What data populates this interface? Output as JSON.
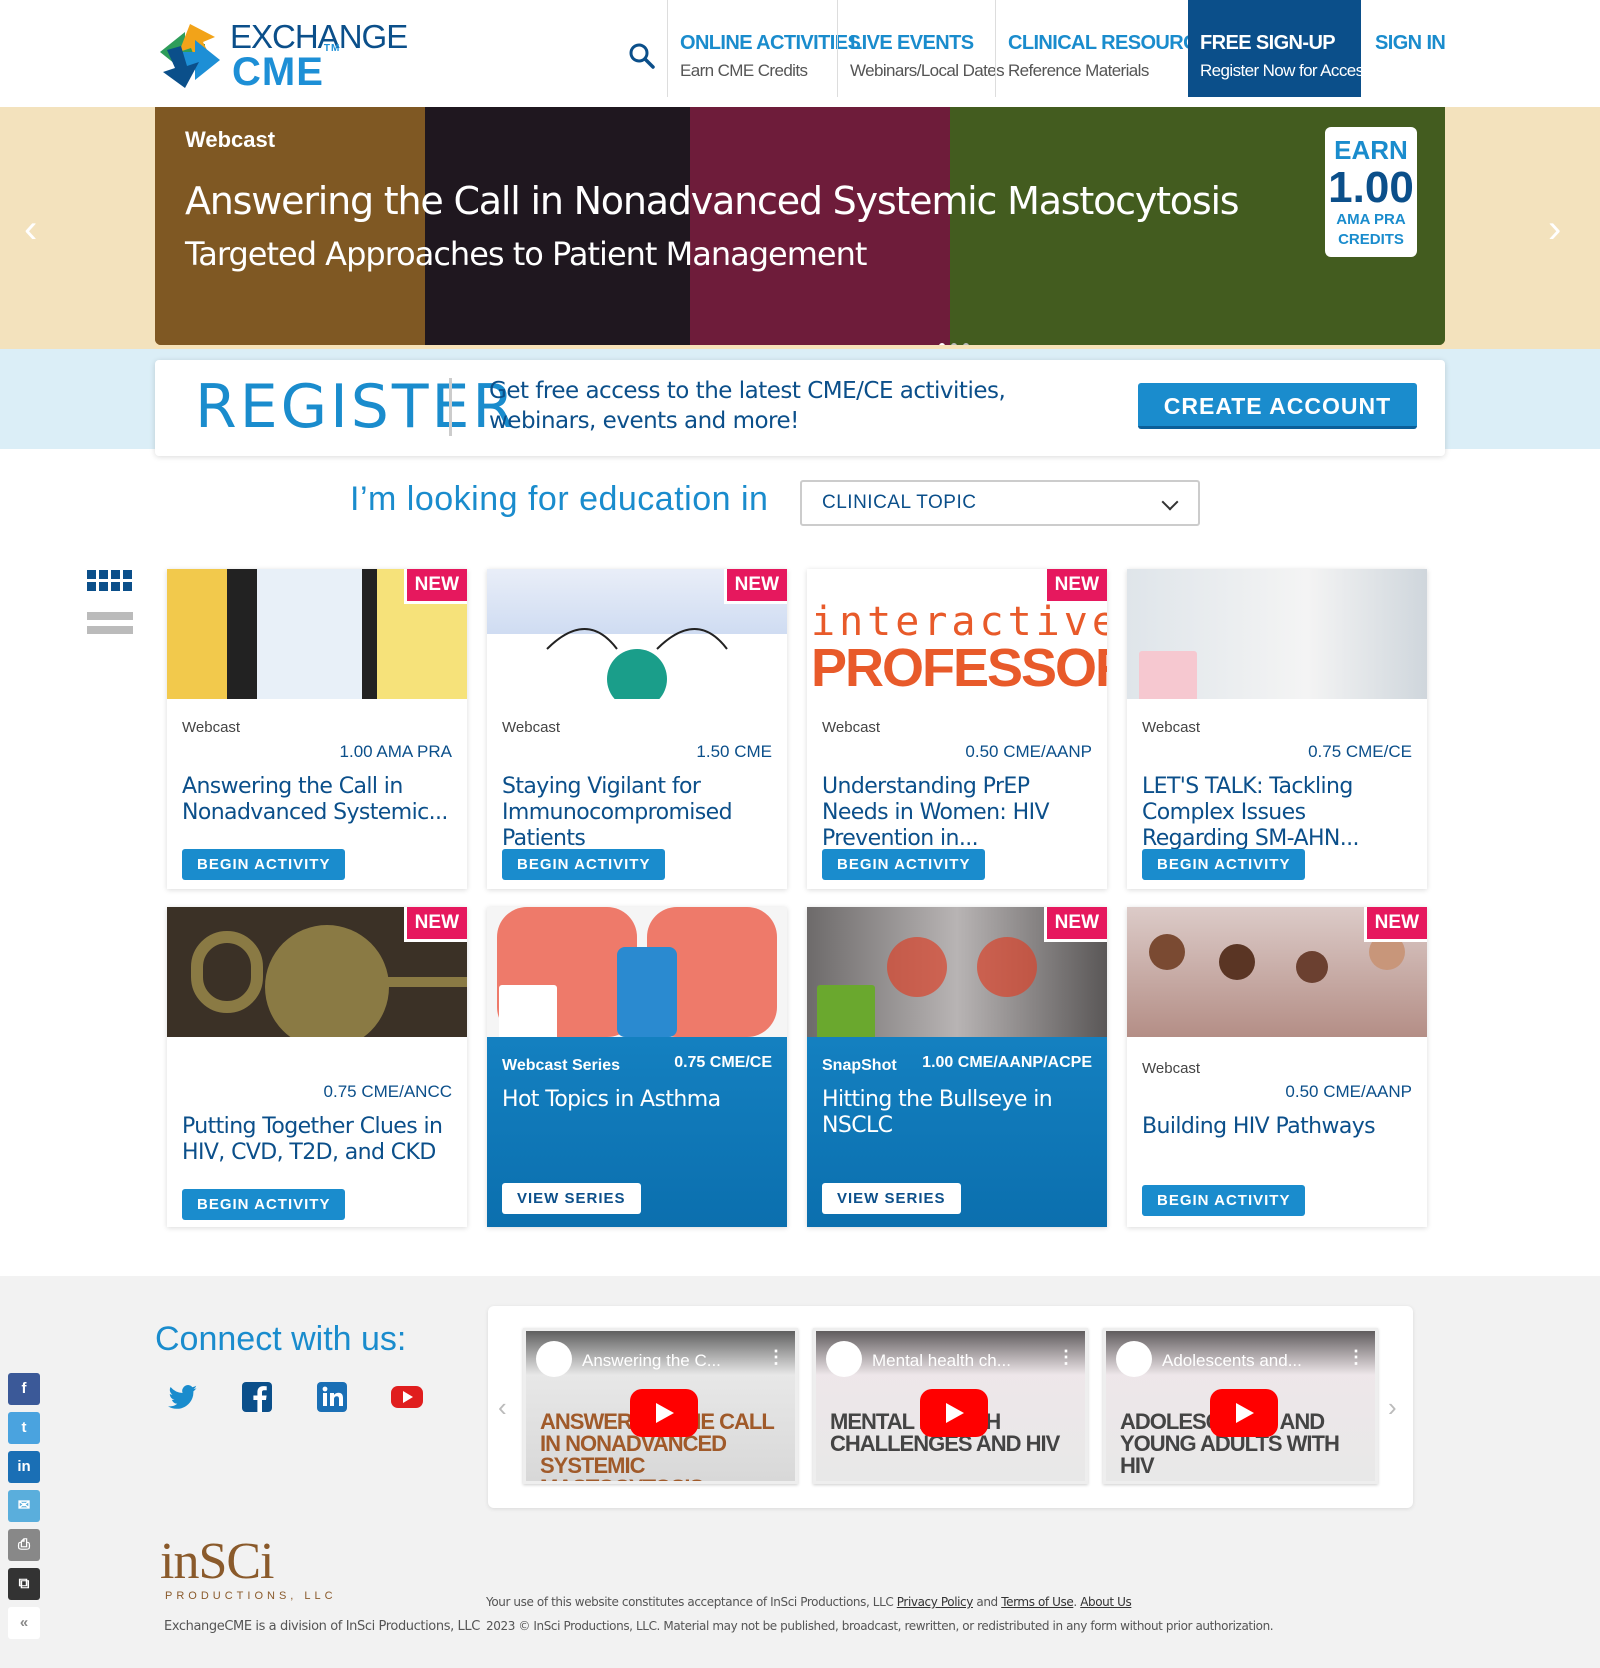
{
  "header": {
    "logo_line1": "EXCHANGE",
    "logo_line2": "CME",
    "logo_tm": "TM",
    "nav": [
      {
        "title": "ONLINE ACTIVITIES",
        "sub": "Earn CME Credits"
      },
      {
        "title": "LIVE EVENTS",
        "sub": "Webinars/Local Dates"
      },
      {
        "title": "CLINICAL RESOURCES",
        "sub": "Reference Materials"
      },
      {
        "title": "FREE SIGN-UP",
        "sub": "Register Now for Access"
      }
    ],
    "sign_in": "SIGN IN"
  },
  "hero": {
    "tag": "Webcast",
    "title": "Answering the Call in Nonadvanced Systemic Mastocytosis",
    "subtitle": "Targeted Approaches to Patient Management",
    "earn_label": "EARN",
    "earn_value": "1.00",
    "earn_unit": "AMA PRA CREDITS",
    "prev": "‹",
    "next": "›"
  },
  "register": {
    "title": "REGISTER",
    "text": "Get free access to the latest CME/CE activities, webinars, events and more!",
    "button": "CREATE ACCOUNT"
  },
  "filter": {
    "label": "I’m looking for education in",
    "selected": "CLINICAL TOPIC"
  },
  "cards": [
    {
      "new": "NEW",
      "type": "Webcast",
      "credit": "1.00 AMA PRA",
      "title": "Answering the Call in Nonadvanced Systemic...",
      "button": "BEGIN ACTIVITY"
    },
    {
      "new": "NEW",
      "type": "Webcast",
      "credit": "1.50 CME",
      "title": "Staying Vigilant for Immunocompromised Patients",
      "button": "BEGIN ACTIVITY"
    },
    {
      "new": "NEW",
      "type": "Webcast",
      "credit": "0.50 CME/AANP",
      "title": "Understanding PrEP Needs in Women: HIV Prevention in...",
      "button": "BEGIN ACTIVITY"
    },
    {
      "type": "Webcast",
      "credit": "0.75 CME/CE",
      "title": "LET'S TALK: Tackling Complex Issues Regarding SM-AHN...",
      "button": "BEGIN ACTIVITY"
    },
    {
      "new": "NEW",
      "type": "",
      "credit": "0.75 CME/ANCC",
      "title": "Putting Together Clues in HIV, CVD, T2D, and CKD",
      "button": "BEGIN ACTIVITY"
    },
    {
      "type": "Webcast Series",
      "credit": "0.75 CME/CE",
      "title": "Hot Topics in Asthma",
      "button": "VIEW SERIES"
    },
    {
      "new": "NEW",
      "type": "SnapShot",
      "credit": "1.00 CME/AANP/ACPE",
      "title": "Hitting the Bullseye in NSCLC",
      "button": "VIEW SERIES"
    },
    {
      "new": "NEW",
      "type": "Webcast",
      "credit": "0.50 CME/AANP",
      "title": "Building HIV Pathways",
      "button": "BEGIN ACTIVITY"
    }
  ],
  "card_images": {
    "img1": "interactive",
    "img2": "PROFESSOR"
  },
  "footer": {
    "connect": "Connect with us:",
    "videos": [
      {
        "title": "Answering the C...",
        "overlay": "ANSWERING THE CALL IN NONADVANCED SYSTEMIC MASTOCYTOSIS"
      },
      {
        "title": "Mental health ch...",
        "overlay": "MENTAL HEALTH CHALLENGES AND HIV"
      },
      {
        "title": "Adolescents and...",
        "overlay": "ADOLESCENTS AND YOUNG ADULTS WITH HIV"
      }
    ],
    "insci": "inSCi",
    "insci_prod": "PRODUCTIONS, LLC",
    "division": "ExchangeCME is a division of InSci Productions, LLC",
    "legal_prefix": "Your use of this website constitutes acceptance of InSci Productions, LLC",
    "privacy": "Privacy Policy",
    "and": "and",
    "terms": "Terms of Use",
    "about": "About Us",
    "copyright": "2023 © InSci Productions, LLC. Material may not be published, broadcast, rewritten, or redistributed in any form without prior authorization."
  },
  "share": [
    "f",
    "t",
    "in",
    "✉",
    "⎙",
    "⧉",
    "«"
  ],
  "colors": {
    "brand_blue": "#1a8ccd",
    "navy": "#0b4f8a",
    "new_pink": "#e6185e"
  }
}
